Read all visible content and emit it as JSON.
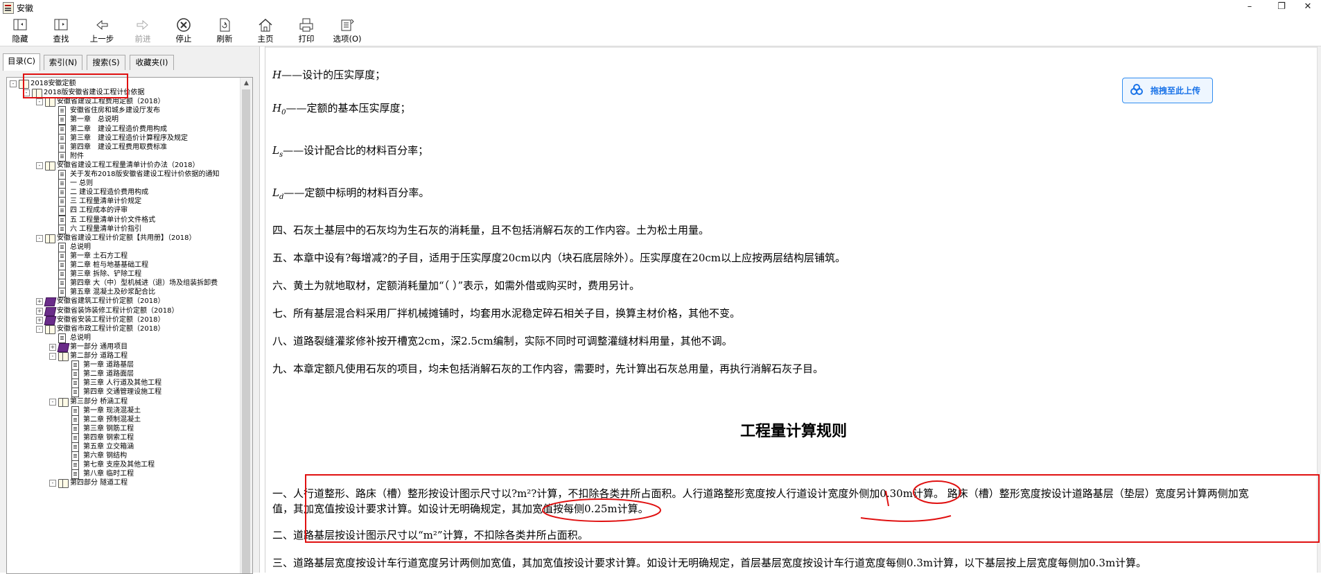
{
  "window": {
    "title": "安徽",
    "controls": [
      "–",
      "❐",
      "✕"
    ]
  },
  "toolbar": {
    "hide": "隐藏",
    "find": "查找",
    "back": "上一步",
    "forward": "前进",
    "stop": "停止",
    "refresh": "刷新",
    "home": "主页",
    "print": "打印",
    "options": "选项(O)"
  },
  "tabs": {
    "contents": "目录(C)",
    "index": "索引(N)",
    "search": "搜索(S)",
    "favorites": "收藏夹(I)"
  },
  "tree": [
    "2018安徽定额",
    "2018版安徽省建设工程计价依据",
    "安徽省建设工程费用定额（2018）",
    "安徽省住房和城乡建设厅发布",
    "第一章　总说明",
    "第二章　建设工程造价费用构成",
    "第三章　建设工程造价计算程序及规定",
    "第四章　建设工程费用取费标准",
    "附件",
    "安徽省建设工程工程量清单计价办法（2018）",
    "关于发布2018版安徽省建设工程计价依据的通知",
    "一 总则",
    "二 建设工程造价费用构成",
    "三 工程量清单计价规定",
    "四 工程成本的评审",
    "五 工程量清单计价文件格式",
    "六 工程量清单计价指引",
    "安徽省建设工程计价定额【共用册】（2018）",
    "总说明",
    "第一章 土石方工程",
    "第二章 桩与地基基础工程",
    "第三章 拆除、铲除工程",
    "第四章 大（中）型机械进（退）场及组装拆卸费",
    "第五章 混凝土及砂浆配合比",
    "安徽省建筑工程计价定额（2018）",
    "安徽省装饰装修工程计价定额（2018）",
    "安徽省安装工程计价定额（2018）",
    "安徽省市政工程计价定额（2018）",
    "总说明",
    "第一部分 通用项目",
    "第二部分 道路工程",
    "第一章 道路基层",
    "第二章 道路面层",
    "第三章 人行道及其他工程",
    "第四章 交通管理设施工程",
    "第三部分 桥涵工程",
    "第一章 现浇混凝土",
    "第二章 预制混凝土",
    "第三章 钢筋工程",
    "第四章 钢索工程",
    "第五章 立交箱涵",
    "第六章 钢结构",
    "第七章 支座及其他工程",
    "第八章 临时工程",
    "第四部分 隧道工程"
  ],
  "content": {
    "defs": [
      {
        "sym": "H",
        "sub": "",
        "text": "——设计的压实厚度；"
      },
      {
        "sym": "H",
        "sub": "0",
        "text": "——定额的基本压实厚度；"
      },
      {
        "sym": "L",
        "sub": "s",
        "text": "——设计配合比的材料百分率；"
      },
      {
        "sym": "L",
        "sub": "d",
        "text": "——定额中标明的材料百分率。"
      }
    ],
    "paras": [
      "四、石灰土基层中的石灰均为生石灰的消耗量，且不包括消解石灰的工作内容。土为松土用量。",
      "五、本章中设有?每增减?的子目，适用于压实厚度20cm以内（块石底层除外）。压实厚度在20cm以上应按两层结构层铺筑。",
      "六、黄土为就地取材，定额消耗量加“（ ）”表示，如需外借或购买时，费用另计。",
      "七、所有基层混合料采用厂拌机械摊铺时，均套用水泥稳定碎石相关子目，换算主材价格，其他不变。",
      "八、道路裂缝灌浆修补按开槽宽2cm，深2.5cm编制，实际不同时可调整灌缝材料用量，其他不调。",
      "九、本章定额凡使用石灰的项目，均未包括消解石灰的工作内容，需要时，先计算出石灰总用量，再执行消解石灰子目。"
    ],
    "heading": "工程量计算规则",
    "rules": [
      "一、人行道整形、路床（槽）整形按设计图示尺寸以?m²?计算，不扣除各类井所占面积。人行道路整形宽度按人行道设计宽度外侧加0.30m计算。 路床（槽）整形宽度按设计道路基层（垫层）宽度另计算两侧加宽",
      "值，其加宽值按设计要求计算。如设计无明确规定，其加宽值按每侧0.25m计算。",
      "二、道路基层按设计图示尺寸以“m²”计算，不扣除各类井所占面积。",
      "三、道路基层宽度按设计车行道宽度另计两侧加宽值，其加宽值按设计要求计算。如设计无明确规定，首层基层宽度按设计车行道宽度每侧0.3m计算，以下基层按上层宽度每侧加0.3m计算。"
    ]
  },
  "upload_button": "拖拽至此上传",
  "colors": {
    "annotation": "#e01010",
    "upload": "#2f8cf0"
  }
}
